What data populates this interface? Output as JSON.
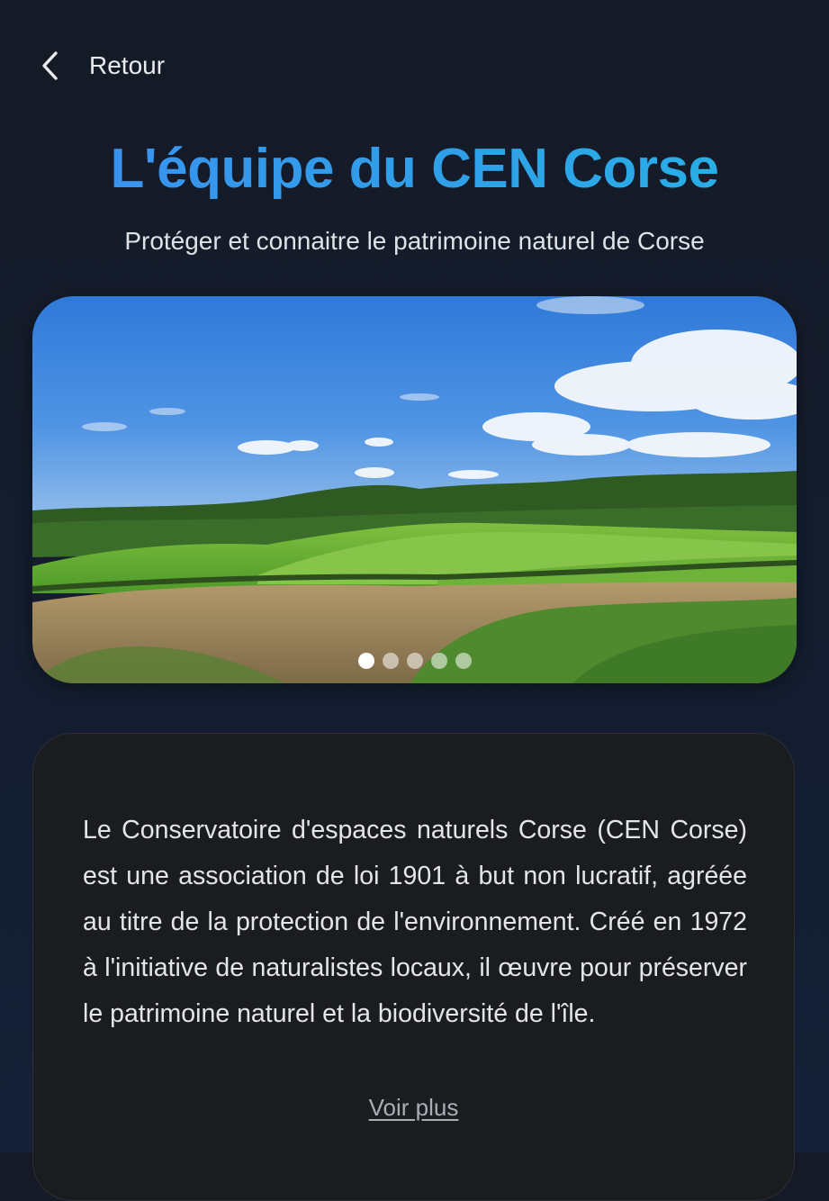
{
  "header": {
    "back_label": "Retour"
  },
  "page": {
    "title": "L'équipe du CEN Corse",
    "subtitle": "Protéger et connaitre le patrimoine naturel de Corse"
  },
  "carousel": {
    "slide_count": 5,
    "active_index": 0
  },
  "about": {
    "text": "Le Conservatoire d'espaces naturels Corse (CEN Corse) est une association de loi 1901 à but non lucratif, agréée au titre de la protection de l'environnement. Créé en 1972 à l'initiative de naturalistes locaux, il œuvre pour préserver le patrimoine naturel et la biodiversité de l'île.",
    "more_label": "Voir plus"
  },
  "colors": {
    "background": "#151a26",
    "title_gradient_start": "#3c8ff0",
    "title_gradient_end": "#27b4e6",
    "card_background": "#1b1c20"
  },
  "icons": {
    "back": "chevron-left-icon"
  }
}
